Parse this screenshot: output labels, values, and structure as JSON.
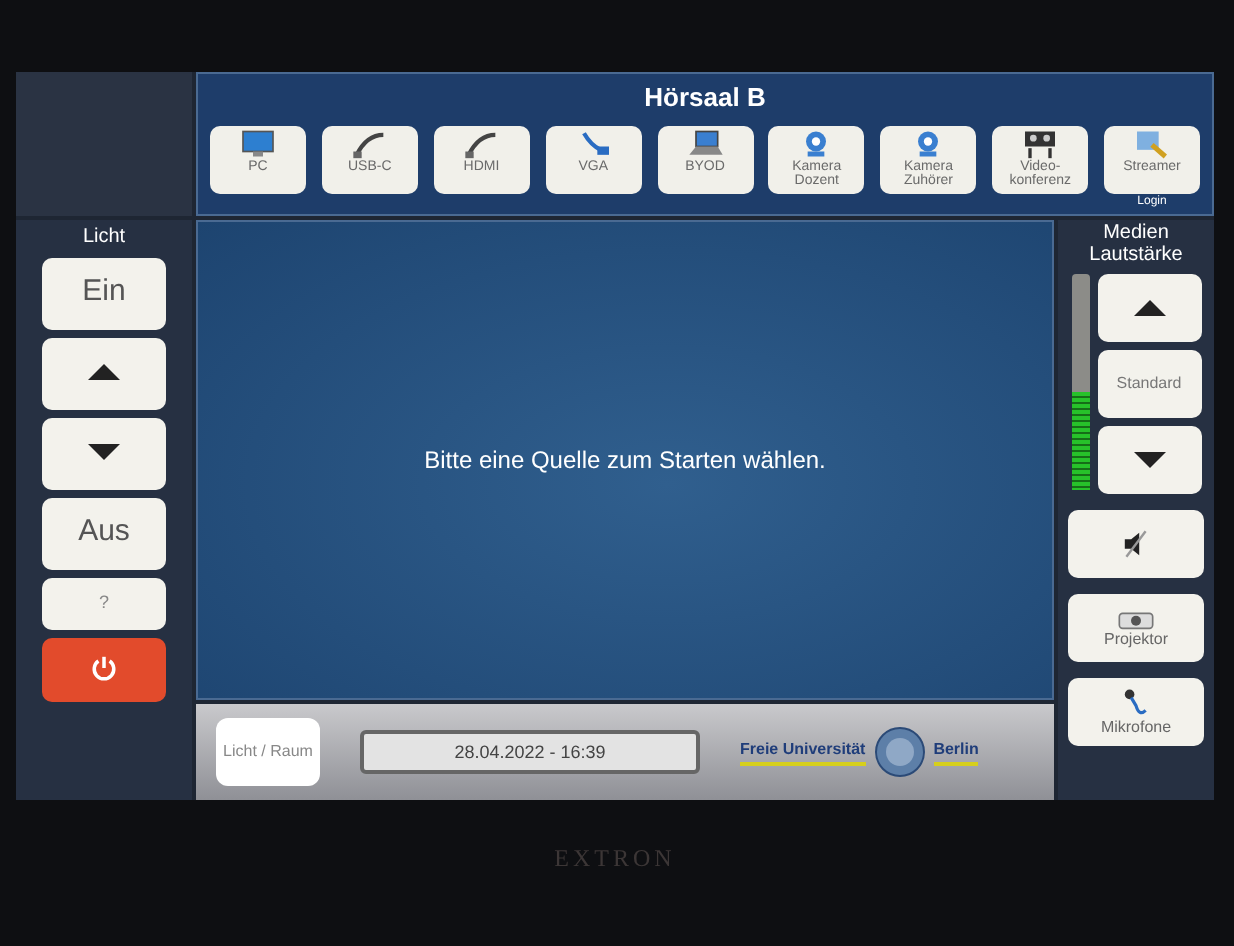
{
  "header": {
    "title": "Hörsaal B"
  },
  "sources": [
    {
      "label": "PC",
      "kind": "pc"
    },
    {
      "label": "USB-C",
      "kind": "cable"
    },
    {
      "label": "HDMI",
      "kind": "cable"
    },
    {
      "label": "VGA",
      "kind": "vga"
    },
    {
      "label": "BYOD",
      "kind": "laptop"
    },
    {
      "label": "Kamera Dozent",
      "kind": "camera"
    },
    {
      "label": "Kamera Zuhörer",
      "kind": "camera"
    },
    {
      "label": "Video-konferenz",
      "kind": "video"
    },
    {
      "label": "Streamer",
      "kind": "streamer",
      "sublabel": "Login"
    }
  ],
  "light": {
    "title": "Licht",
    "buttons": [
      {
        "kind": "text",
        "label": "Ein"
      },
      {
        "kind": "up"
      },
      {
        "kind": "down"
      },
      {
        "kind": "text",
        "label": "Aus"
      },
      {
        "kind": "small",
        "label": "?"
      },
      {
        "kind": "power"
      }
    ]
  },
  "main": {
    "message": "Bitte eine Quelle zum Starten wählen."
  },
  "bottom": {
    "room_button": "Licht / Raum",
    "datetime": "28.04.2022  -  16:39",
    "logo_left": "Freie Universität",
    "logo_right": "Berlin"
  },
  "volume": {
    "title": "Medien Lautstärke",
    "level": 0.45,
    "buttons": [
      {
        "kind": "up"
      },
      {
        "kind": "text",
        "label": "Standard"
      },
      {
        "kind": "down"
      }
    ]
  },
  "right_buttons": [
    {
      "kind": "mute"
    },
    {
      "kind": "projector",
      "label": "Projektor"
    },
    {
      "kind": "mic",
      "label": "Mikrofone"
    }
  ],
  "bezel": {
    "brand": "EXTRON"
  }
}
